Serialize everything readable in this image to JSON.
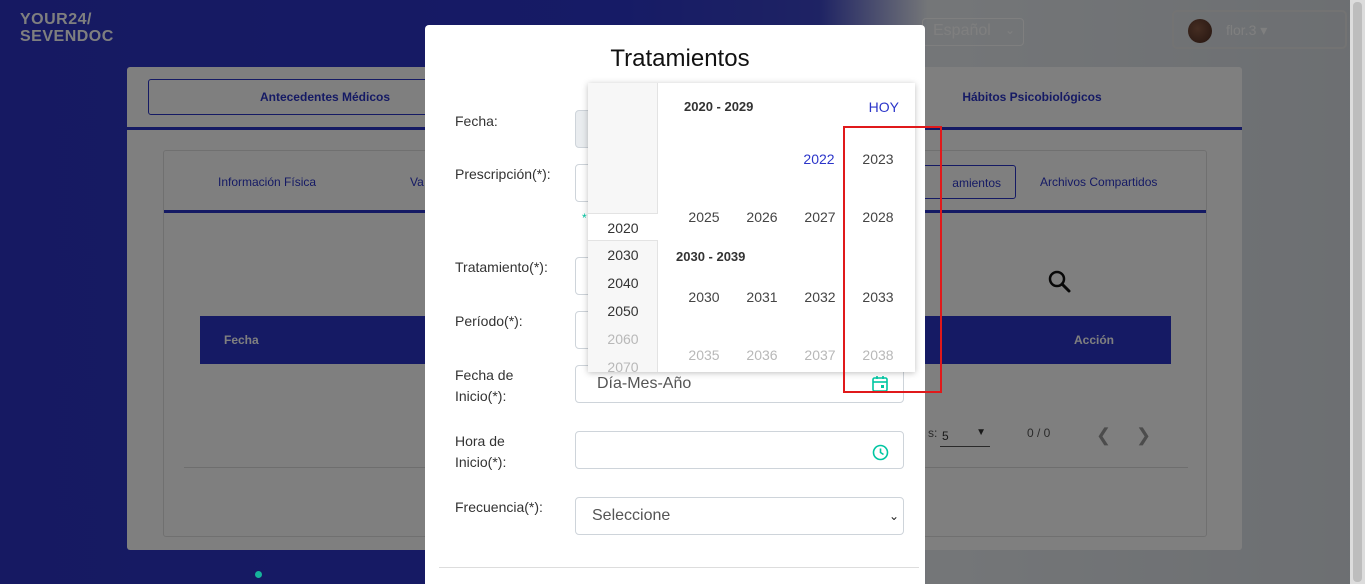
{
  "logo": {
    "line1": "YOUR24/",
    "line2": "SEVENDOC"
  },
  "language": {
    "value": "Español"
  },
  "user": {
    "name": "flor.3"
  },
  "card": {
    "tabs": {
      "antecedentes": "Antecedentes Médicos",
      "habitos": "Hábitos Psicobiológicos"
    },
    "inner_tabs": {
      "fisica": "Información Física",
      "va": "Va",
      "tratamientos": "amientos",
      "archivos": "Archivos Compartidos"
    },
    "table": {
      "col_fecha": "Fecha",
      "col_accion": "Acción"
    },
    "pager": {
      "rows_label": "s:",
      "rows_value": "5",
      "range": "0 / 0"
    }
  },
  "modal": {
    "title": "Tratamientos",
    "fields": {
      "fecha": "Fecha:",
      "prescripcion": "Prescripción(*):",
      "hint": "*",
      "tratamiento": "Tratamiento(*):",
      "periodo": "Período(*):",
      "fecha_inicio_1": "Fecha de",
      "fecha_inicio_2": "Inicio(*):",
      "fecha_inicio_placeholder": "Día-Mes-Año",
      "hora_inicio_1": "Hora de",
      "hora_inicio_2": "Inicio(*):",
      "frecuencia": "Frecuencia(*):",
      "frecuencia_value": "Seleccione"
    }
  },
  "picker": {
    "decades": [
      "2020",
      "2030",
      "2040",
      "2050",
      "2060",
      "2070"
    ],
    "today_label": "HOY",
    "group1": {
      "label": "2020 - 2029",
      "row1": [
        "2022",
        "2023"
      ],
      "row2": [
        "2025",
        "2026",
        "2027",
        "2028"
      ]
    },
    "group2": {
      "label": "2030 - 2039",
      "row1": [
        "2030",
        "2031",
        "2032",
        "2033"
      ],
      "row2": [
        "2035",
        "2036",
        "2037",
        "2038"
      ]
    }
  },
  "colors": {
    "brand": "#2b35c9",
    "accent": "#00c6a2",
    "highlight": "#e0191b"
  }
}
